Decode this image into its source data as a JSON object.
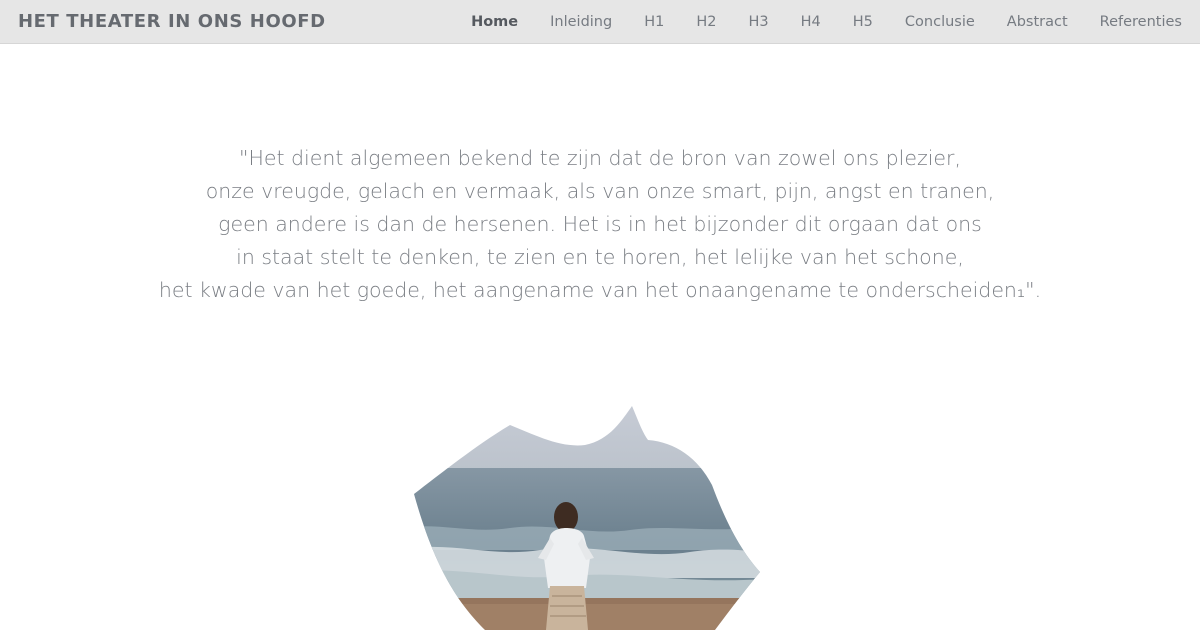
{
  "header": {
    "site_title": "HET THEATER IN ONS HOOFD",
    "nav": [
      {
        "label": "Home",
        "active": true
      },
      {
        "label": "Inleiding",
        "active": false
      },
      {
        "label": "H1",
        "active": false
      },
      {
        "label": "H2",
        "active": false
      },
      {
        "label": "H3",
        "active": false
      },
      {
        "label": "H4",
        "active": false
      },
      {
        "label": "H5",
        "active": false
      },
      {
        "label": "Conclusie",
        "active": false
      },
      {
        "label": "Abstract",
        "active": false
      },
      {
        "label": "Referenties",
        "active": false
      }
    ]
  },
  "quote": {
    "lines": [
      "\"Het dient algemeen bekend te zijn dat de bron van zowel ons plezier,",
      "onze vreugde, gelach en vermaak, als van onze smart, pijn, angst en tranen,",
      "geen andere is dan de hersenen. Het is in het bijzonder dit orgaan dat ons",
      "in staat stelt te denken, te zien en te horen, het lelijke van het schone,",
      "het kwade van het goede, het aangename van het onaangename te onderscheiden₁\"."
    ]
  },
  "colors": {
    "topbar_bg": "#e6e6e6",
    "text_gray": "#7a7e84",
    "sky": "#c3c9d3",
    "sea": "#6f8592",
    "sand": "#9b7c62"
  }
}
